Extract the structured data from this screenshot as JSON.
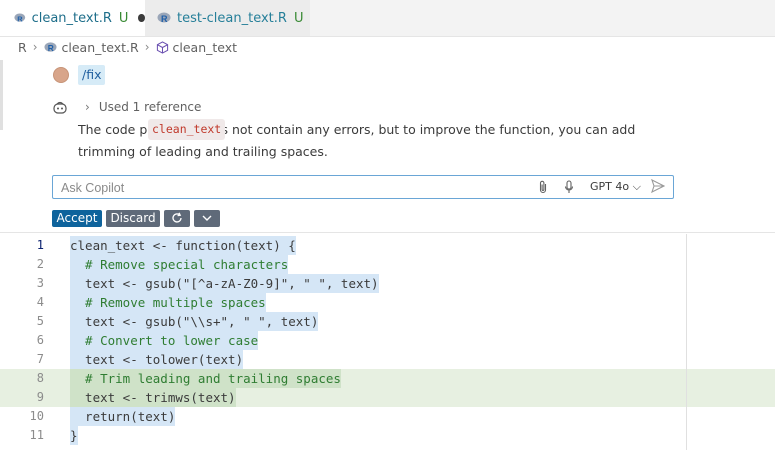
{
  "tabs": [
    {
      "name": "clean_text.R",
      "status": "U",
      "active": true
    },
    {
      "name": "test-clean_text.R",
      "status": "U",
      "active": false
    }
  ],
  "breadcrumb": {
    "root": "R",
    "file": "clean_text.R",
    "symbol": "clean_text"
  },
  "chat": {
    "user_command": "/fix",
    "reference": "Used 1 reference",
    "answer_before": "The code provided does not contain any errors, but to improve the ",
    "answer_code": "clean_text",
    "answer_after": " function, you can add trimming of leading and trailing spaces."
  },
  "input": {
    "placeholder": "Ask Copilot",
    "model": "GPT 4o"
  },
  "actions": {
    "accept": "Accept",
    "discard": "Discard"
  },
  "editor": {
    "line_numbers": [
      "1",
      "2",
      "3",
      "4",
      "5",
      "6",
      "7",
      "8",
      "9",
      "10",
      "11"
    ],
    "lines": [
      "clean_text <- function(text) {",
      "  # Remove special characters",
      "  text <- gsub(\"[^a-zA-Z0-9]\", \" \", text)",
      "  # Remove multiple spaces",
      "  text <- gsub(\"\\\\s+\", \" \", text)",
      "  # Convert to lower case",
      "  text <- tolower(text)",
      "  # Trim leading and trailing spaces",
      "  text <- trimws(text)",
      "  return(text)",
      "}"
    ],
    "added_lines": [
      8,
      9
    ]
  },
  "colors": {
    "accent": "#0e639c",
    "added_bg": "#e7f0e1",
    "selection": "#d5e6f6"
  }
}
